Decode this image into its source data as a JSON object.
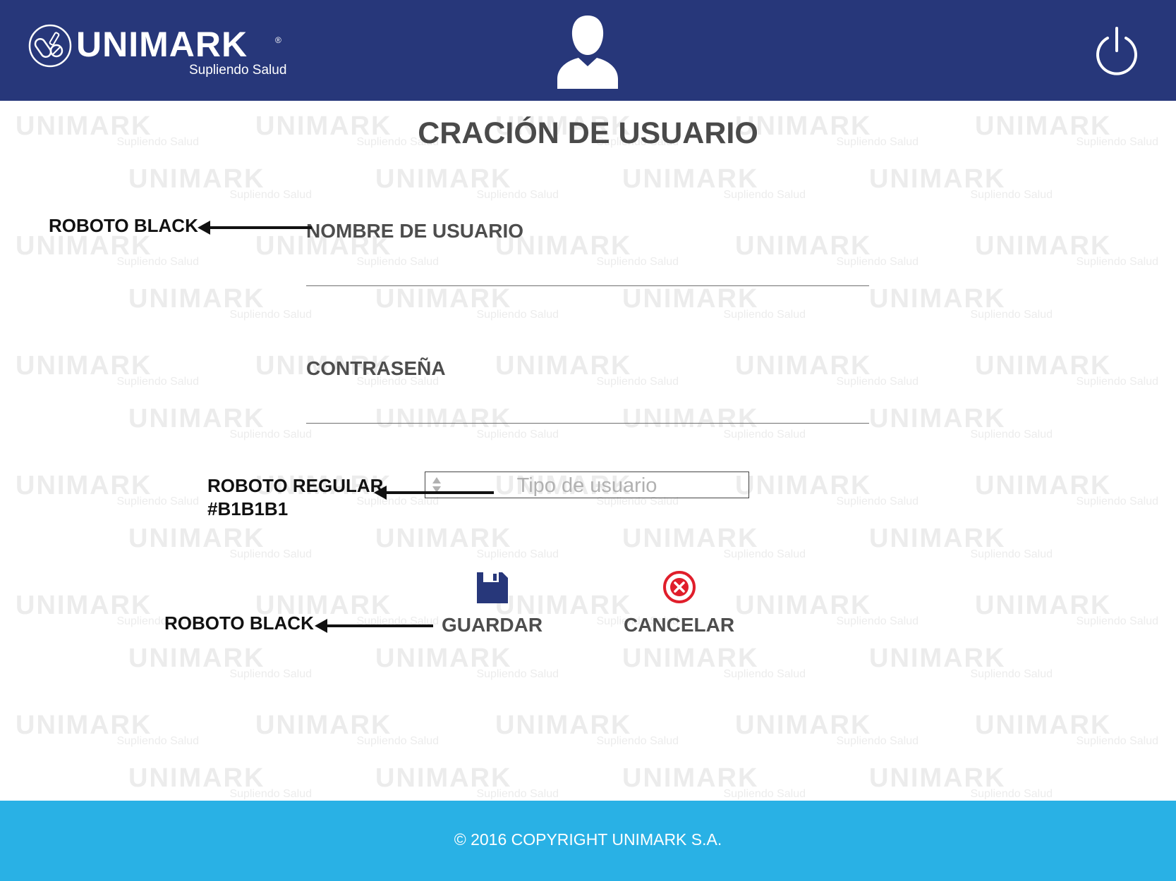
{
  "header": {
    "logo_text": "UNIMARK",
    "logo_registered": "®",
    "logo_tagline": "Supliendo Salud",
    "user_icon": "user-icon",
    "power_icon": "power-icon"
  },
  "watermark": {
    "brand": "UNIMARK",
    "tagline": "Supliendo Salud"
  },
  "form": {
    "title": "CRACIÓN DE USUARIO",
    "username_label": "NOMBRE DE USUARIO",
    "username_value": "",
    "password_label": "CONTRASEÑA",
    "password_value": "",
    "user_type_placeholder": "Tipo de usuario"
  },
  "actions": {
    "save_label": "GUARDAR",
    "save_icon": "floppy-disk-icon",
    "cancel_label": "CANCELAR",
    "cancel_icon": "cancel-circle-icon"
  },
  "annotations": {
    "label_font_note": "ROBOTO BLACK",
    "placeholder_font_note_line1": "ROBOTO REGULAR",
    "placeholder_font_note_line2": "#B1B1B1",
    "button_font_note": "ROBOTO BLACK"
  },
  "footer": {
    "copyright": "© 2016 COPYRIGHT UNIMARK S.A."
  },
  "colors": {
    "header_bg": "#27377a",
    "footer_bg": "#29b1e5",
    "placeholder_text": "#B1B1B1",
    "cancel_red": "#e01e2b",
    "save_blue": "#27377a"
  }
}
